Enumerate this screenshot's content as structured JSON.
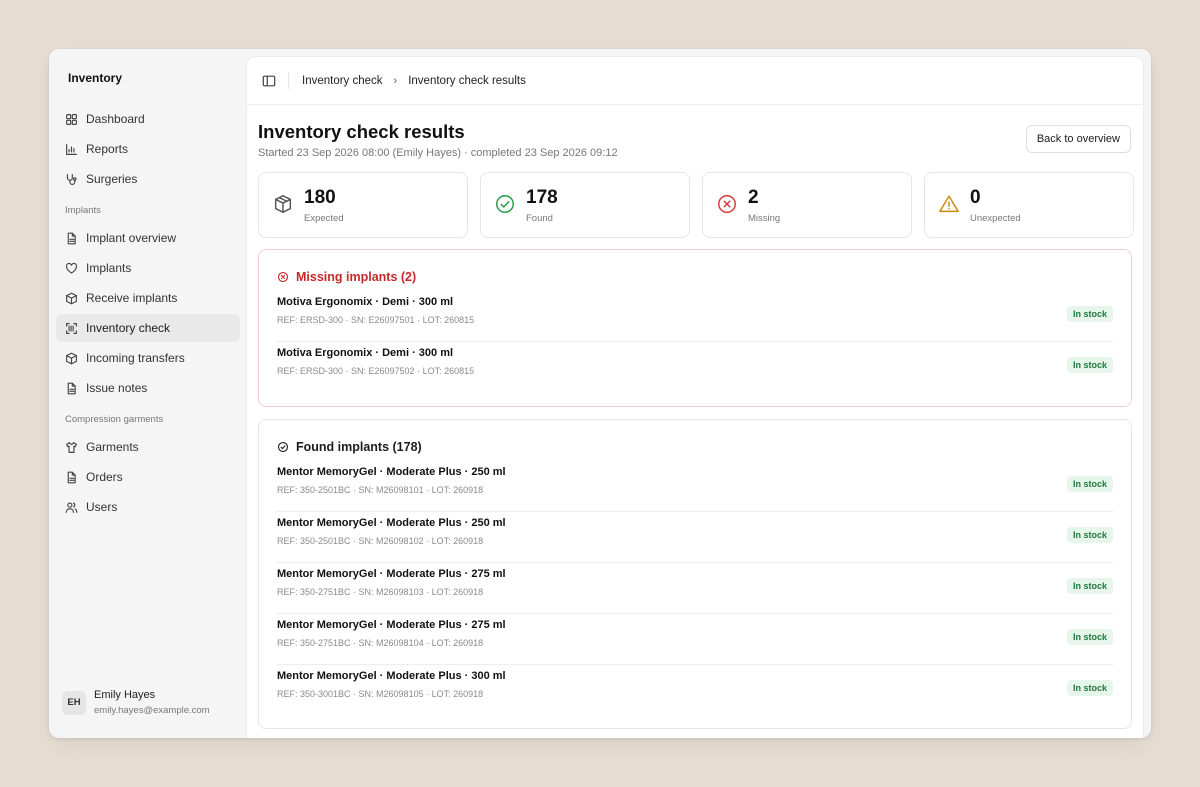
{
  "app": {
    "title": "Inventory"
  },
  "nav": {
    "main": [
      {
        "label": "Dashboard",
        "icon": "dashboard-icon"
      },
      {
        "label": "Reports",
        "icon": "chart-icon"
      },
      {
        "label": "Surgeries",
        "icon": "stethoscope-icon"
      }
    ],
    "implants_section": "Implants",
    "implants": [
      {
        "label": "Implant overview",
        "icon": "document-icon"
      },
      {
        "label": "Implants",
        "icon": "heart-icon"
      },
      {
        "label": "Receive implants",
        "icon": "box-icon"
      },
      {
        "label": "Inventory check",
        "icon": "scan-icon",
        "active": true
      },
      {
        "label": "Incoming transfers",
        "icon": "box-icon"
      },
      {
        "label": "Issue notes",
        "icon": "document-icon"
      }
    ],
    "garments_section": "Compression garments",
    "garments": [
      {
        "label": "Garments",
        "icon": "shirt-icon"
      },
      {
        "label": "Orders",
        "icon": "document-icon"
      },
      {
        "label": "Users",
        "icon": "users-icon"
      }
    ]
  },
  "user": {
    "initials": "EH",
    "name": "Emily Hayes",
    "email": "emily.hayes@example.com"
  },
  "breadcrumb": {
    "parent": "Inventory check",
    "current": "Inventory check results"
  },
  "header": {
    "title": "Inventory check results",
    "subtitle": "Started 23 Sep 2026 08:00 (Emily Hayes) · completed 23 Sep 2026 09:12",
    "back_label": "Back to overview"
  },
  "stats": {
    "expected": {
      "value": "180",
      "label": "Expected",
      "color": "#555555"
    },
    "found": {
      "value": "178",
      "label": "Found",
      "color": "#1f9d4a"
    },
    "missing": {
      "value": "2",
      "label": "Missing",
      "color": "#d23a3a"
    },
    "unexpected": {
      "value": "0",
      "label": "Unexpected",
      "color": "#c98a12"
    }
  },
  "missing": {
    "title": "Missing implants (2)",
    "items": [
      {
        "name": "Motiva Ergonomix · Demi · 300 ml",
        "meta": "REF: ERSD-300 · SN: E26097501 · LOT: 260815",
        "status": "In stock"
      },
      {
        "name": "Motiva Ergonomix · Demi · 300 ml",
        "meta": "REF: ERSD-300 · SN: E26097502 · LOT: 260815",
        "status": "In stock"
      }
    ]
  },
  "found": {
    "title": "Found implants (178)",
    "items": [
      {
        "name": "Mentor MemoryGel · Moderate Plus · 250 ml",
        "meta": "REF: 350-2501BC · SN: M26098101 · LOT: 260918",
        "status": "In stock"
      },
      {
        "name": "Mentor MemoryGel · Moderate Plus · 250 ml",
        "meta": "REF: 350-2501BC · SN: M26098102 · LOT: 260918",
        "status": "In stock"
      },
      {
        "name": "Mentor MemoryGel · Moderate Plus · 275 ml",
        "meta": "REF: 350-2751BC · SN: M26098103 · LOT: 260918",
        "status": "In stock"
      },
      {
        "name": "Mentor MemoryGel · Moderate Plus · 275 ml",
        "meta": "REF: 350-2751BC · SN: M26098104 · LOT: 260918",
        "status": "In stock"
      },
      {
        "name": "Mentor MemoryGel · Moderate Plus · 300 ml",
        "meta": "REF: 350-3001BC · SN: M26098105 · LOT: 260918",
        "status": "In stock"
      }
    ]
  }
}
